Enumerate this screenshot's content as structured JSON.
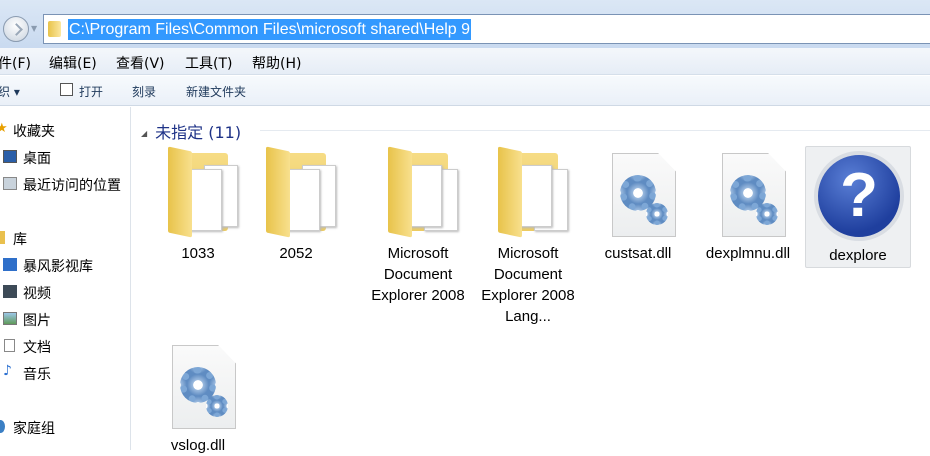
{
  "address": {
    "path": "C:\\Program Files\\Common Files\\microsoft shared\\Help 9"
  },
  "menu": [
    "件(F)",
    "编辑(E)",
    "查看(V)",
    "工具(T)",
    "帮助(H)"
  ],
  "toolbar": {
    "organize": "织 ▾",
    "open": "打开",
    "burn": "刻录",
    "new_folder": "新建文件夹"
  },
  "sidebar": [
    {
      "label": "收藏夹",
      "icon": "star-icon"
    },
    {
      "label": "桌面",
      "icon": "desktop-icon"
    },
    {
      "label": "最近访问的位置",
      "icon": "recent-places-icon"
    },
    {
      "label": "库",
      "icon": "library-icon"
    },
    {
      "label": "暴风影视库",
      "icon": "media-library-icon"
    },
    {
      "label": "视频",
      "icon": "video-icon"
    },
    {
      "label": "图片",
      "icon": "pictures-icon"
    },
    {
      "label": "文档",
      "icon": "documents-icon"
    },
    {
      "label": "音乐",
      "icon": "music-icon"
    },
    {
      "label": "家庭组",
      "icon": "homegroup-icon"
    }
  ],
  "group": {
    "title": "未指定 (11)"
  },
  "items": [
    {
      "name": "1033",
      "type": "folder"
    },
    {
      "name": "2052",
      "type": "folder"
    },
    {
      "name": "Microsoft Document Explorer 2008",
      "type": "folder"
    },
    {
      "name": "Microsoft Document Explorer 2008 Lang...",
      "type": "folder"
    },
    {
      "name": "custsat.dll",
      "type": "dll"
    },
    {
      "name": "dexplmnu.dll",
      "type": "dll"
    },
    {
      "name": "dexplore",
      "type": "help-exe"
    },
    {
      "name": "vslog.dll",
      "type": "dll"
    }
  ]
}
